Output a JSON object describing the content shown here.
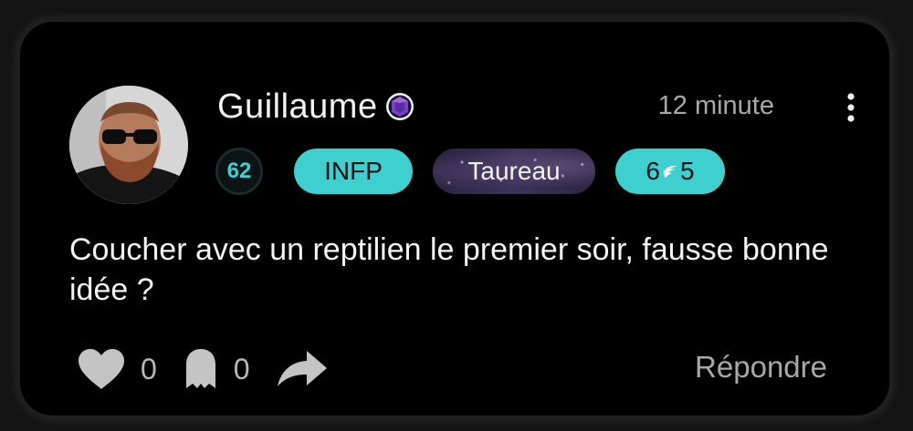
{
  "post": {
    "username": "Guillaume",
    "timestamp": "12 minute",
    "badges": {
      "level": "62",
      "mbti": "INFP",
      "zodiac": "Taureau",
      "enneagram_core": "6",
      "enneagram_wing": "5"
    },
    "text": "Coucher avec un reptilien le premier soir, fausse bonne idée ?",
    "likes": "0",
    "boos": "0",
    "reply_label": "Répondre"
  },
  "icons": {
    "verified": "purple-gem-icon",
    "more": "vertical-ellipsis-icon",
    "wing": "wing-icon",
    "like": "heart-icon",
    "boo": "ghost-icon",
    "share": "share-arrow-icon"
  },
  "colors": {
    "accent": "#3ecfcf",
    "level_text": "#3bd0d2",
    "gem": "#7a3fc4",
    "background": "#000000"
  }
}
